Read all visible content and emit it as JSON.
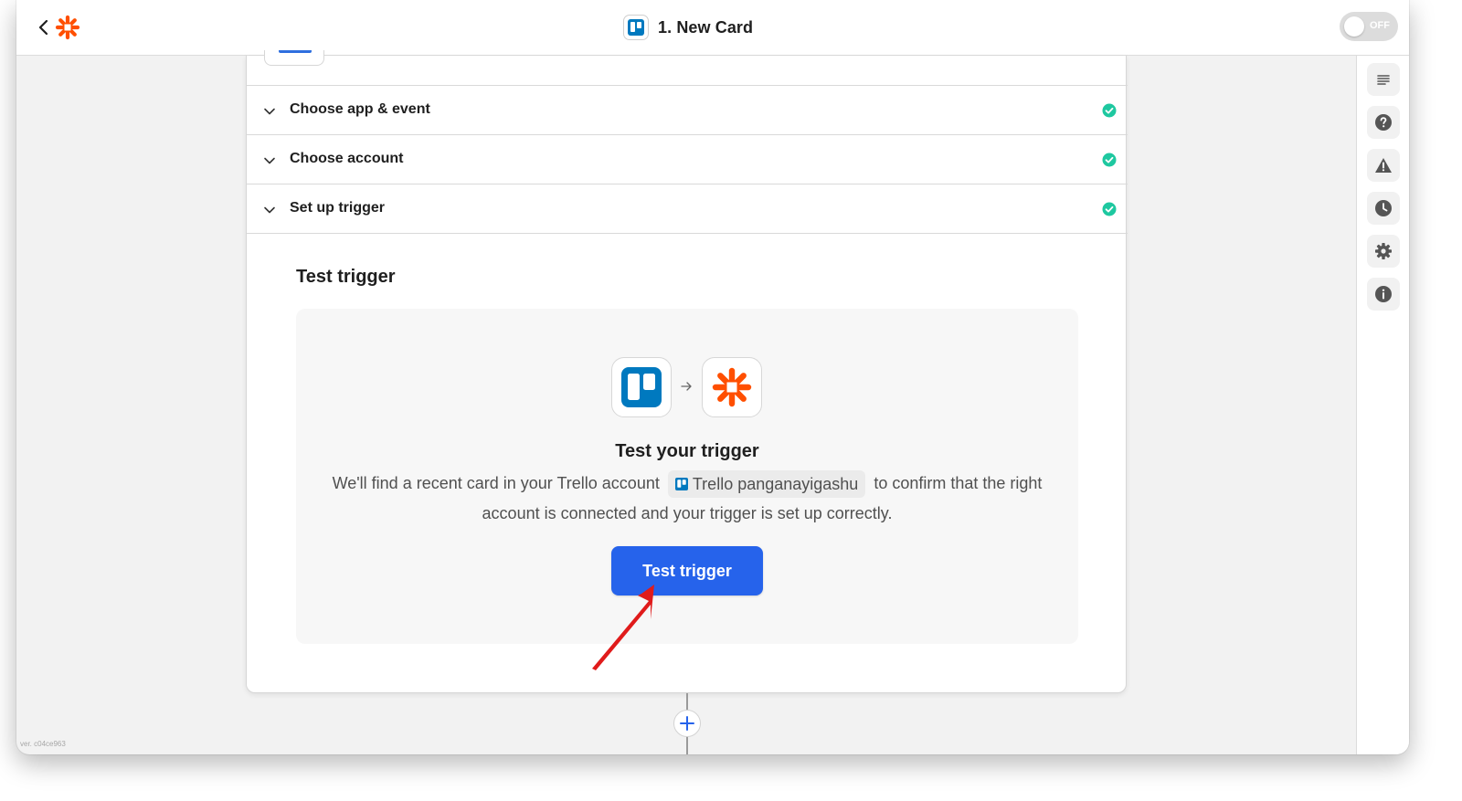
{
  "topbar": {
    "title": "1. New Card",
    "toggle_label": "OFF"
  },
  "sections": [
    {
      "label": "Choose app & event",
      "status": "complete"
    },
    {
      "label": "Choose account",
      "status": "complete"
    },
    {
      "label": "Set up trigger",
      "status": "complete"
    }
  ],
  "test": {
    "heading": "Test trigger",
    "title": "Test your trigger",
    "desc_before": "We'll find a recent card in your Trello account",
    "account_name": "Trello panganayigashu",
    "desc_after": "to confirm that the right",
    "desc_line2": "account is connected and your trigger is set up correctly.",
    "button_label": "Test trigger"
  },
  "right_rail": [
    "notes-icon",
    "help-icon",
    "alert-icon",
    "history-icon",
    "settings-icon",
    "info-icon"
  ],
  "version": "ver. c04ce963",
  "colors": {
    "accent_blue": "#2663eb",
    "zapier_orange": "#ff4f00",
    "trello_blue": "#0079bf",
    "success_green": "#1ec8a0",
    "annotation_red": "#e01b1b"
  }
}
